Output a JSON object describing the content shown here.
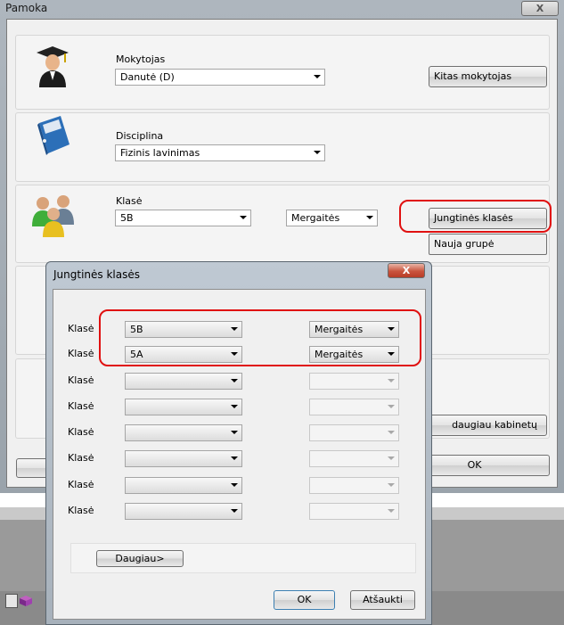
{
  "main": {
    "title": "Pamoka",
    "close": "X",
    "teacher": {
      "label": "Mokytojas",
      "value": "Danutė (D)",
      "other_btn": "Kitas mokytojas"
    },
    "discipline": {
      "label": "Disciplina",
      "value": "Fizinis lavinimas"
    },
    "class": {
      "label": "Klasė",
      "value": "5B",
      "group": "Mergaitės",
      "joint_btn": "Jungtinės klasės",
      "new_group_btn": "Nauja grupė"
    },
    "more_rooms_btn": "daugiau kabinetų",
    "ok_btn": "OK"
  },
  "dialog": {
    "title": "Jungtinės klasės",
    "close": "X",
    "rows": [
      {
        "label": "Klasė",
        "class": "5B",
        "group": "Mergaitės"
      },
      {
        "label": "Klasė",
        "class": "5A",
        "group": "Mergaitės"
      },
      {
        "label": "Klasė",
        "class": "",
        "group": ""
      },
      {
        "label": "Klasė",
        "class": "",
        "group": ""
      },
      {
        "label": "Klasė",
        "class": "",
        "group": ""
      },
      {
        "label": "Klasė",
        "class": "",
        "group": ""
      },
      {
        "label": "Klasė",
        "class": "",
        "group": ""
      },
      {
        "label": "Klasė",
        "class": "",
        "group": ""
      }
    ],
    "more_btn": "Daugiau>",
    "ok_btn": "OK",
    "cancel_btn": "Atšaukti"
  },
  "colors": {
    "highlight": "#e01010",
    "close_button": "#c9543d"
  }
}
